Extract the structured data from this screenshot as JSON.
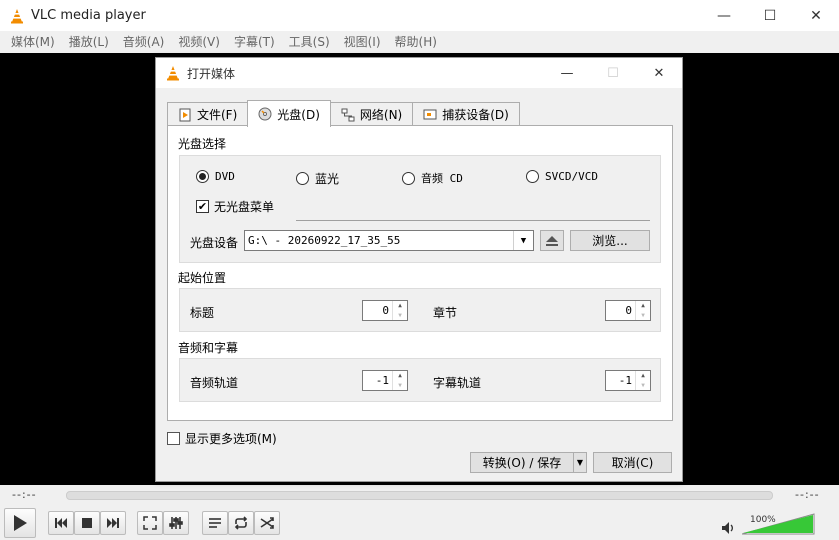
{
  "window": {
    "title": "VLC media player",
    "min": "—",
    "max": "☐",
    "close": "✕"
  },
  "menubar": [
    {
      "label": "媒体(M)"
    },
    {
      "label": "播放(L)"
    },
    {
      "label": "音频(A)"
    },
    {
      "label": "视频(V)"
    },
    {
      "label": "字幕(T)"
    },
    {
      "label": "工具(S)"
    },
    {
      "label": "视图(I)"
    },
    {
      "label": "帮助(H)"
    }
  ],
  "dialog": {
    "title": "打开媒体",
    "tabs": [
      {
        "label": "文件(F)"
      },
      {
        "label": "光盘(D)"
      },
      {
        "label": "网络(N)"
      },
      {
        "label": "捕获设备(D)"
      }
    ],
    "disc_selection": {
      "label": "光盘选择",
      "options": [
        "DVD",
        "蓝光",
        "音频 CD",
        "SVCD/VCD"
      ],
      "selected": "DVD",
      "no_menu_label": "无光盘菜单",
      "no_menu_checked": true,
      "device_label": "光盘设备",
      "device_value": "G:\\ - 20260922_17_35_55",
      "browse_label": "浏览..."
    },
    "start_position": {
      "label": "起始位置",
      "title_label": "标题",
      "title_value": "0",
      "chapter_label": "章节",
      "chapter_value": "0"
    },
    "audio_subtitles": {
      "label": "音频和字幕",
      "audio_label": "音频轨道",
      "audio_value": "-1",
      "subtitle_label": "字幕轨道",
      "subtitle_value": "-1"
    },
    "show_more_label": "显示更多选项(M)",
    "convert_label": "转换(O) / 保存",
    "cancel_label": "取消(C)"
  },
  "player": {
    "elapsed": "--:--",
    "remaining": "--:--",
    "volume": "100%",
    "volume_level": 1.0
  },
  "colors": {
    "volume_fill": "#37c837",
    "accent": "#f28c00"
  }
}
